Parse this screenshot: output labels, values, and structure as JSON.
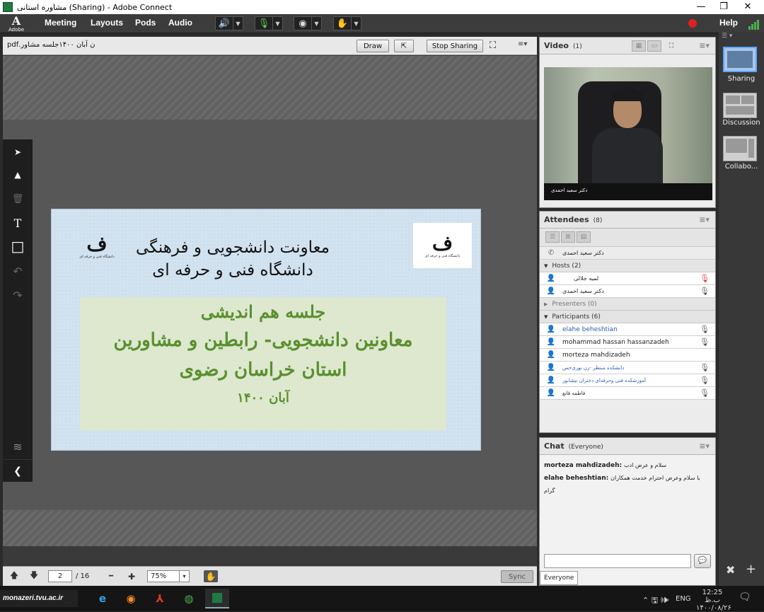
{
  "window": {
    "title": "مشاوره استانی (Sharing) - Adobe Connect",
    "minimize": "—",
    "restore": "❐",
    "close": "✕"
  },
  "menubar": {
    "logo_letter": "A",
    "logo_text": "Adobe",
    "items": [
      "Meeting",
      "Layouts",
      "Pods",
      "Audio"
    ],
    "help": "Help"
  },
  "share_pod": {
    "filename": "ن آبان ۱۴۰۰جلسه مشاور.pdf",
    "draw": "Draw",
    "stop_sharing": "Stop Sharing",
    "menu_icon": "≡▾"
  },
  "tools": {
    "arrow": "➤",
    "marker": "▲",
    "trash": "🗑",
    "text": "T",
    "rect": "□",
    "undo": "↶",
    "redo": "↷",
    "layers": "≋",
    "collapse": "❮"
  },
  "slide": {
    "title_line1": "معاونت دانشجویی و فرهنگی",
    "title_line2": "دانشگاه فنی و حرفه ای",
    "green_line1": "جلسه هم اندیشی",
    "green_line2": "معاونین دانشجویی- رابطین و مشاورین",
    "green_line3": "استان خراسان رضوی",
    "green_line4": "آبان ۱۴۰۰",
    "logo_mark": "ف",
    "logo_caption": "دانشگاه فنی و حرفه ای"
  },
  "share_footer": {
    "page": "2",
    "total": "/ 16",
    "zoom": "75%",
    "sync": "Sync",
    "zoom_arrow": "▾",
    "minus": "━",
    "plus": "✚"
  },
  "video_pod": {
    "title": "Video",
    "count": "(1)",
    "caption": "دکتر سعید احمدی"
  },
  "attendees_pod": {
    "title": "Attendees",
    "count": "(8)",
    "self_name": "دکتر سعید احمدی",
    "hosts_label": "Hosts (2)",
    "hosts": [
      "لمیه جلالی",
      "دکتر سعید احمدی"
    ],
    "presenters_label": "Presenters (0)",
    "participants_label": "Participants (6)",
    "participants": [
      {
        "name": "elahe beheshtian",
        "color": "#2a5db0"
      },
      {
        "name": "mohammad hassan hassanzadeh",
        "color": "#222"
      },
      {
        "name": "morteza mahdizadeh",
        "color": "#222"
      },
      {
        "name": "دانشکده منتظر -زن نوری‌حس",
        "color": "#2a5db0"
      },
      {
        "name": "آموزشکده فنی وحرفه‌ای دختران نیشابور",
        "color": "#2a5db0"
      },
      {
        "name": "فاطمه قانع",
        "color": "#222"
      }
    ]
  },
  "chat_pod": {
    "title": "Chat",
    "scope": "(Everyone)",
    "messages": [
      {
        "sender": "morteza mahdizadeh:",
        "text": "سلام و عرض ادب"
      },
      {
        "sender": "elahe beheshtian:",
        "text": "با سلام وعرض احترام خدمت همکاران گرام"
      }
    ],
    "tab": "Everyone",
    "send_icon": "💬"
  },
  "layouts": [
    {
      "label": "Sharing"
    },
    {
      "label": "Discussion"
    },
    {
      "label": "Collabo..."
    }
  ],
  "taskbar": {
    "site": "monazeri.tvu.ac.ir",
    "lang": "ENG",
    "time": "12:25 ب.ظ",
    "date": "۱۴۰۰/۰۸/۲۶",
    "tray": "⌃ 🖫 🕪"
  },
  "colors": {
    "accent": "#5a8f2e",
    "record": "#e02020",
    "signal": "#4caf50"
  }
}
